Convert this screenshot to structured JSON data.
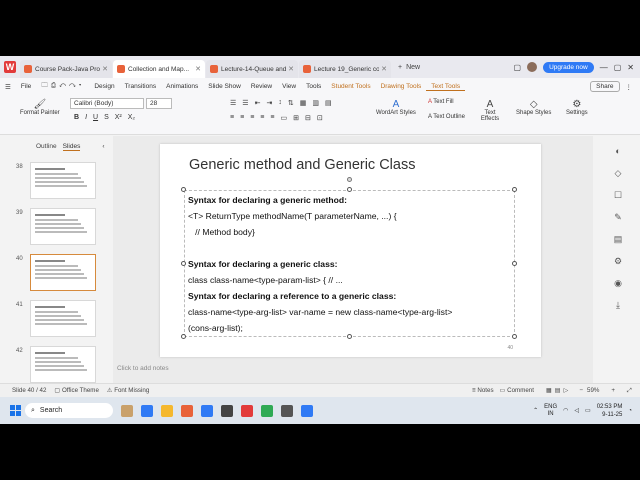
{
  "tabs": [
    {
      "label": "Course Pack-Java Program...",
      "active": false
    },
    {
      "label": "Collection and Map...",
      "active": true
    },
    {
      "label": "Lecture-14-Queue and De...",
      "active": false
    },
    {
      "label": "Lecture 19_Generic collect...",
      "active": false
    }
  ],
  "new_tab": "New",
  "upgrade": "Upgrade now",
  "menu": {
    "file": "File",
    "items": [
      "Design",
      "Transitions",
      "Animations",
      "Slide Show",
      "Review",
      "View",
      "Tools"
    ],
    "context": [
      "Student Tools",
      "Drawing Tools",
      "Text Tools"
    ],
    "share": "Share"
  },
  "ribbon": {
    "format_painter": "Format Painter",
    "font": "Calibri (Body)",
    "size": "28",
    "wordart": "WordArt Styles",
    "text_fill": "Text Fill",
    "text_outline": "Text Outline",
    "text_effects": "Text Effects",
    "shape_styles": "Shape Styles",
    "settings": "Settings"
  },
  "panel": {
    "outline": "Outline",
    "slides": "Slides",
    "thumbs": [
      "38",
      "39",
      "40",
      "41",
      "42"
    ]
  },
  "slide": {
    "title": "Generic method and Generic Class",
    "lines": [
      {
        "text": "Syntax for declaring a generic method:",
        "bold": true
      },
      {
        "text": "<T> ReturnType methodName(T parameterName, ...) {",
        "bold": false
      },
      {
        "text": "   // Method body}",
        "bold": false
      },
      {
        "text": "",
        "bold": false
      },
      {
        "text": "Syntax for declaring a generic class:",
        "bold": true
      },
      {
        "text": "class class-name<type-param-list> { // ...",
        "bold": false
      },
      {
        "text": "Syntax for declaring a reference to a generic class:",
        "bold": true
      },
      {
        "text": "class-name<type-arg-list> var-name = new class-name<type-arg-list>",
        "bold": false
      },
      {
        "text": "(cons-arg-list);",
        "bold": false
      }
    ],
    "page": "40"
  },
  "notes": "Click to add notes",
  "status": {
    "slide": "Slide 40 / 42",
    "theme": "Office Theme",
    "font_missing": "Font Missing",
    "notes": "Notes",
    "comment": "Comment",
    "zoom": "59%"
  },
  "taskbar": {
    "search": "Search",
    "lang": "ENG",
    "region": "IN",
    "time": "02:53 PM",
    "date": "9-11-25"
  }
}
